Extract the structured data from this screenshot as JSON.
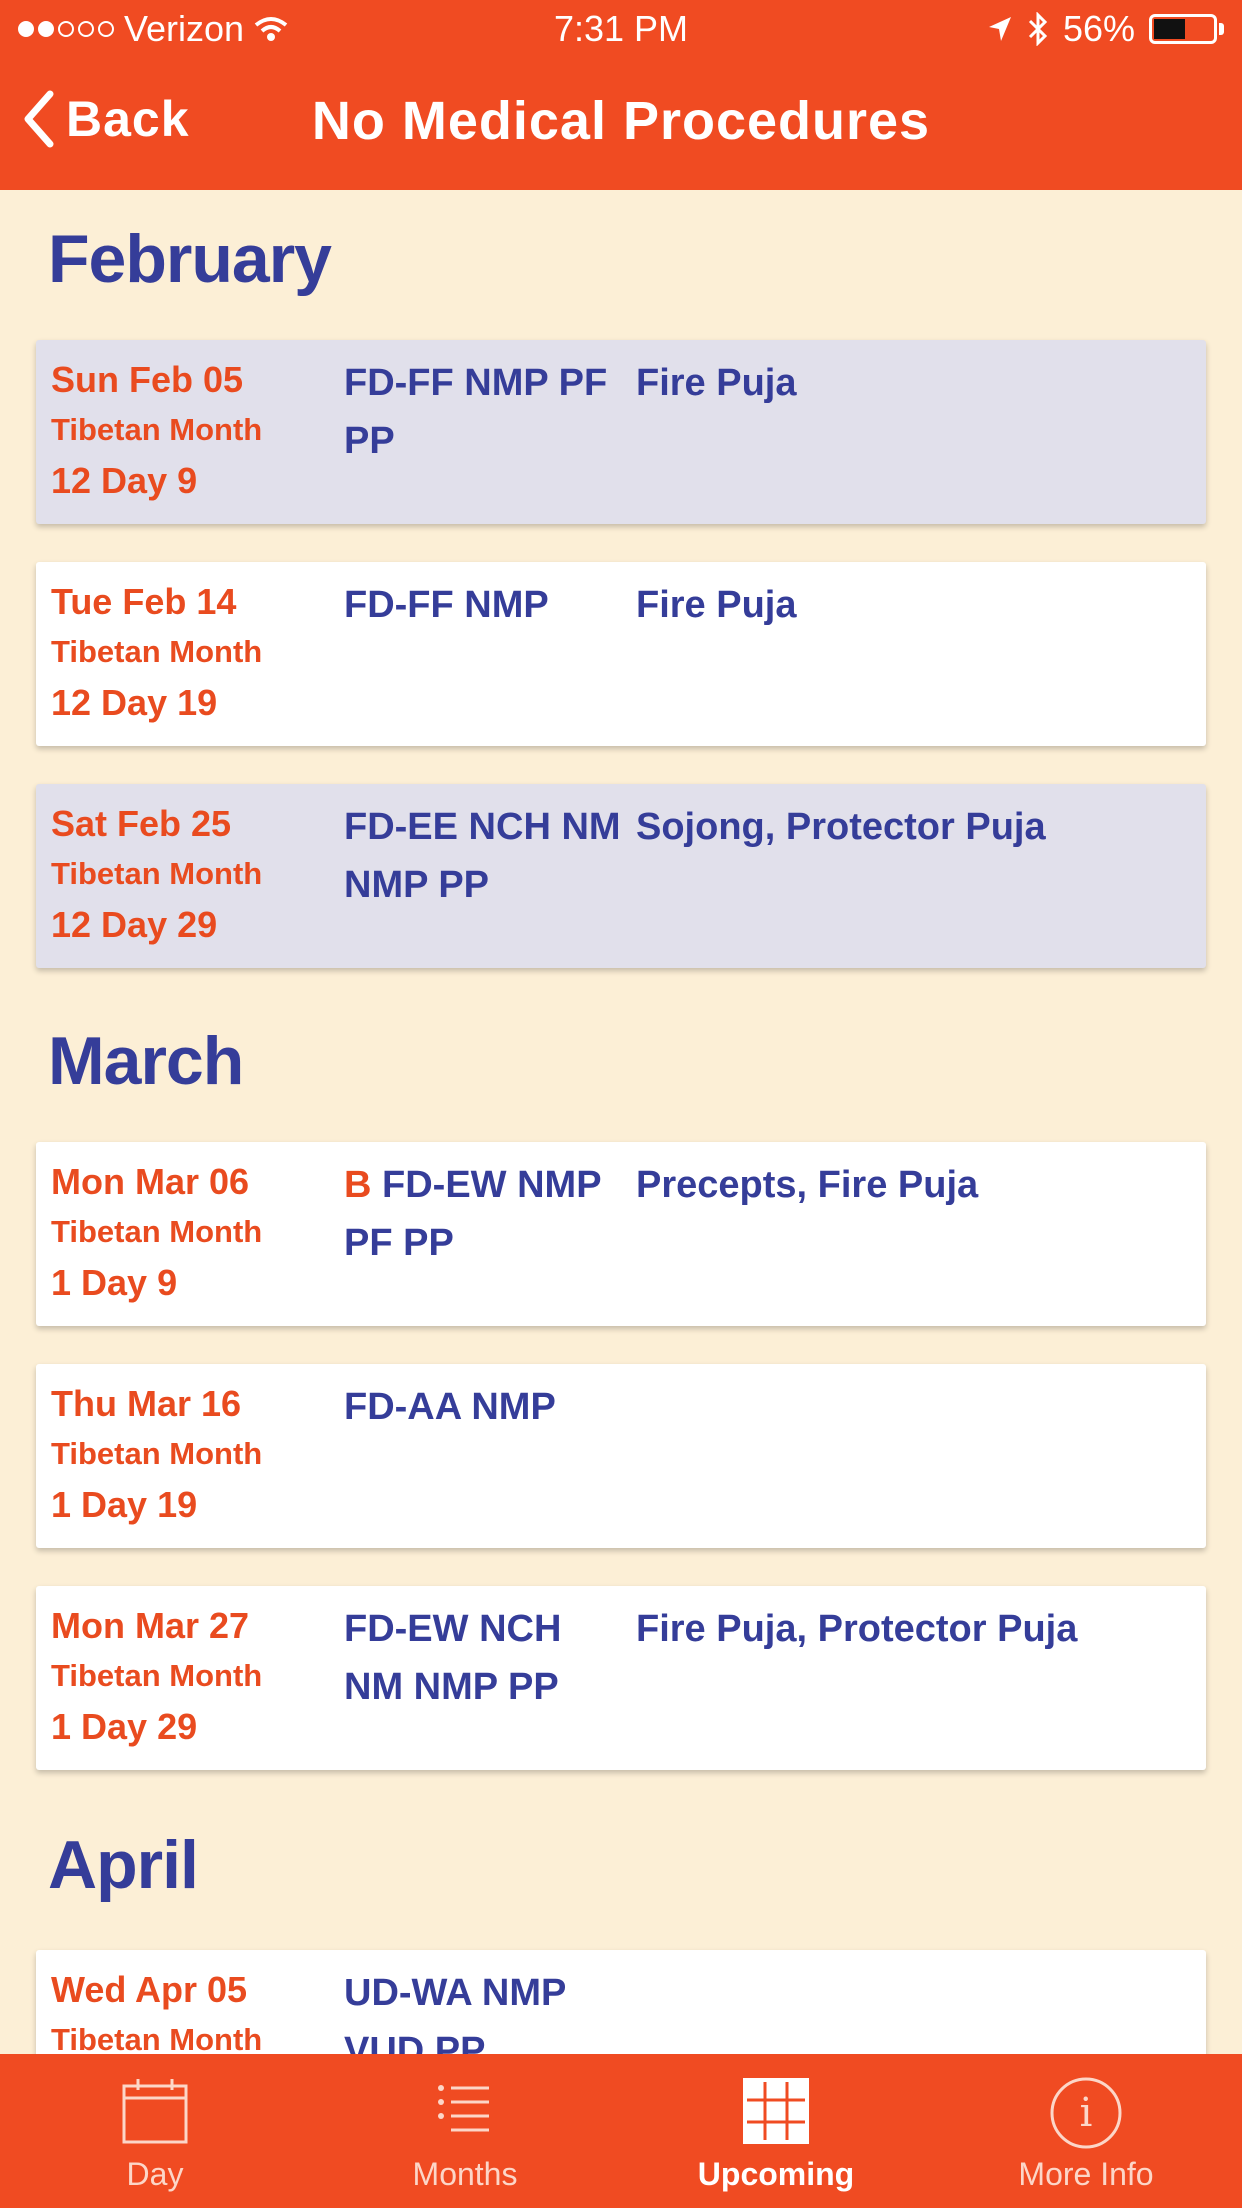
{
  "status_bar": {
    "carrier": "Verizon",
    "time": "7:31 PM",
    "battery": "56%",
    "battery_level": 0.56
  },
  "nav": {
    "back_label": "Back",
    "title": "No Medical Procedures"
  },
  "sections": [
    {
      "month": "February",
      "entries": [
        {
          "date": "Sun Feb 05",
          "tibetan": "Tibetan Month",
          "day": "12 Day 9",
          "codes_prefix": "",
          "codes": "FD-FF NMP PF PP",
          "events": "Fire Puja",
          "shaded": true
        },
        {
          "date": "Tue Feb 14",
          "tibetan": "Tibetan Month",
          "day": "12 Day 19",
          "codes_prefix": "",
          "codes": "FD-FF NMP",
          "events": "Fire Puja",
          "shaded": false
        },
        {
          "date": "Sat Feb 25",
          "tibetan": "Tibetan Month",
          "day": "12 Day 29",
          "codes_prefix": "",
          "codes": "FD-EE NCH NM NMP PP",
          "events": "Sojong, Protector Puja",
          "shaded": true
        }
      ]
    },
    {
      "month": "March",
      "entries": [
        {
          "date": "Mon Mar 06",
          "tibetan": "Tibetan Month",
          "day": "1 Day 9",
          "codes_prefix": "B",
          "codes": "FD-EW NMP PF PP",
          "events": "Precepts, Fire Puja",
          "shaded": false
        },
        {
          "date": "Thu Mar 16",
          "tibetan": "Tibetan Month",
          "day": "1 Day 19",
          "codes_prefix": "",
          "codes": "FD-AA NMP",
          "events": "",
          "shaded": false
        },
        {
          "date": "Mon Mar 27",
          "tibetan": "Tibetan Month",
          "day": "1 Day 29",
          "codes_prefix": "",
          "codes": "FD-EW NCH NM NMP PP",
          "events": "Fire Puja, Protector Puja",
          "shaded": false
        }
      ]
    },
    {
      "month": "April",
      "entries": [
        {
          "date": "Wed Apr 05",
          "tibetan": "Tibetan Month",
          "day": "",
          "codes_prefix": "",
          "codes": "UD-WA NMP VUD PP",
          "events": "",
          "shaded": false
        }
      ]
    }
  ],
  "tabs": [
    {
      "label": "Day",
      "icon": "calendar-icon",
      "active": false
    },
    {
      "label": "Months",
      "icon": "list-icon",
      "active": false
    },
    {
      "label": "Upcoming",
      "icon": "grid-icon",
      "active": true
    },
    {
      "label": "More Info",
      "icon": "info-icon",
      "active": false
    }
  ]
}
